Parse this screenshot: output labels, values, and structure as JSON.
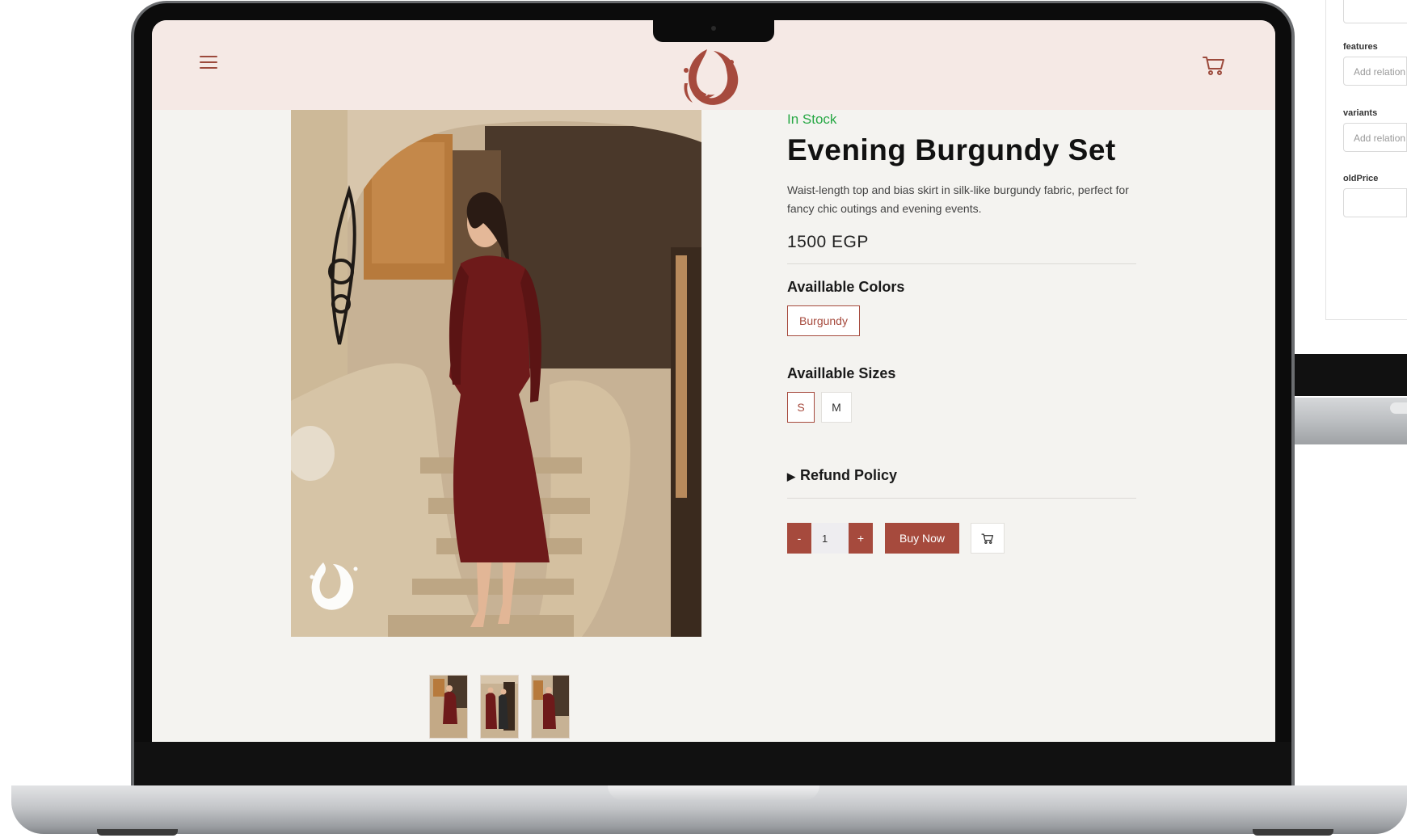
{
  "colors": {
    "brand": "#a64a3d",
    "header_bg": "#f5e9e5",
    "page_bg": "#f4f3f0",
    "stock_green": "#27a845"
  },
  "header": {
    "menu_icon": "hamburger-menu-icon",
    "logo": "brand-logo",
    "cart_icon": "cart-icon"
  },
  "product": {
    "stock_status": "In Stock",
    "title": "Evening Burgundy Set",
    "description": "Waist-length top and bias skirt in silk-like burgundy fabric, perfect for fancy chic outings and evening events.",
    "price": "1500 EGP",
    "colors_label": "Availlable Colors",
    "colors": [
      "Burgundy"
    ],
    "selected_color": "Burgundy",
    "sizes_label": "Availlable Sizes",
    "sizes": [
      "S",
      "M"
    ],
    "selected_size": "S",
    "refund_label": "Refund Policy",
    "refund_marker": "▶",
    "thumbnail_count": 3
  },
  "purchase": {
    "decrement_label": "-",
    "quantity": "1",
    "increment_label": "+",
    "buy_label": "Buy Now"
  },
  "cms_panel": {
    "features_label": "features",
    "features_placeholder": "Add relation",
    "variants_label": "variants",
    "variants_placeholder": "Add relation",
    "old_price_label": "oldPrice"
  }
}
